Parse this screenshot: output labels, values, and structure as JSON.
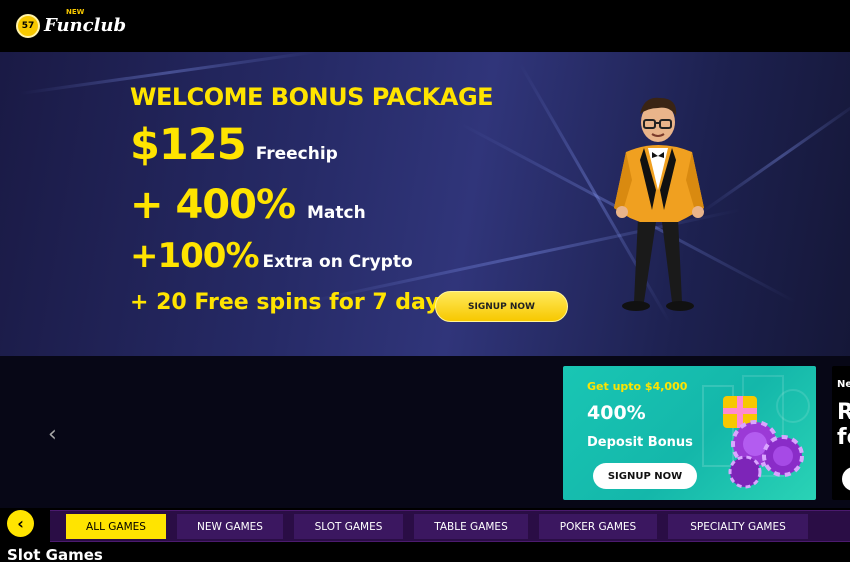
{
  "header": {
    "logo_new": "NEW",
    "logo_text": "Funclub",
    "logo_badge": "57"
  },
  "hero": {
    "title": "WELCOME BONUS PACKAGE",
    "line1_big": "$125",
    "line1_small": "Freechip",
    "line2_big": "+ 400%",
    "line2_small": "Match",
    "line3_big": "+100%",
    "line3_small": "Extra on Crypto",
    "line4": "+ 20 Free spins for 7 days",
    "signup_label": "SIGNUP NOW"
  },
  "carousel": {
    "prev_icon": "chevron-left-icon",
    "prev_glyph": "‹"
  },
  "promo": {
    "top": "Get upto $4,000",
    "percent": "400%",
    "title": "Deposit Bonus",
    "signup_label": "SIGNUP NOW"
  },
  "promo_next": {
    "label": "Ne",
    "big": "R\nfo"
  },
  "tabs": {
    "back_glyph": "‹",
    "items": [
      {
        "label": "ALL GAMES",
        "active": true
      },
      {
        "label": "NEW GAMES",
        "active": false
      },
      {
        "label": "SLOT GAMES",
        "active": false
      },
      {
        "label": "TABLE GAMES",
        "active": false
      },
      {
        "label": "POKER GAMES",
        "active": false
      },
      {
        "label": "SPECIALTY GAMES",
        "active": false
      }
    ]
  },
  "section": {
    "title": "Slot Games"
  },
  "colors": {
    "accent": "#ffe400",
    "tab_bg": "#3b1760",
    "promo_teal": "#19c6b4"
  }
}
